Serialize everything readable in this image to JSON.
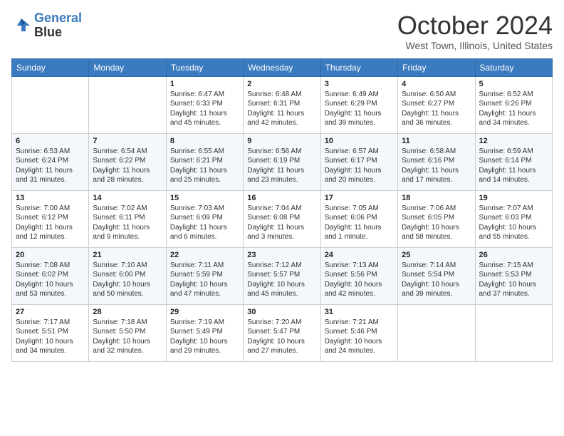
{
  "header": {
    "logo_line1": "General",
    "logo_line2": "Blue",
    "month": "October 2024",
    "location": "West Town, Illinois, United States"
  },
  "days_of_week": [
    "Sunday",
    "Monday",
    "Tuesday",
    "Wednesday",
    "Thursday",
    "Friday",
    "Saturday"
  ],
  "weeks": [
    [
      {
        "day": "",
        "sunrise": "",
        "sunset": "",
        "daylight": ""
      },
      {
        "day": "",
        "sunrise": "",
        "sunset": "",
        "daylight": ""
      },
      {
        "day": "1",
        "sunrise": "Sunrise: 6:47 AM",
        "sunset": "Sunset: 6:33 PM",
        "daylight": "Daylight: 11 hours and 45 minutes."
      },
      {
        "day": "2",
        "sunrise": "Sunrise: 6:48 AM",
        "sunset": "Sunset: 6:31 PM",
        "daylight": "Daylight: 11 hours and 42 minutes."
      },
      {
        "day": "3",
        "sunrise": "Sunrise: 6:49 AM",
        "sunset": "Sunset: 6:29 PM",
        "daylight": "Daylight: 11 hours and 39 minutes."
      },
      {
        "day": "4",
        "sunrise": "Sunrise: 6:50 AM",
        "sunset": "Sunset: 6:27 PM",
        "daylight": "Daylight: 11 hours and 36 minutes."
      },
      {
        "day": "5",
        "sunrise": "Sunrise: 6:52 AM",
        "sunset": "Sunset: 6:26 PM",
        "daylight": "Daylight: 11 hours and 34 minutes."
      }
    ],
    [
      {
        "day": "6",
        "sunrise": "Sunrise: 6:53 AM",
        "sunset": "Sunset: 6:24 PM",
        "daylight": "Daylight: 11 hours and 31 minutes."
      },
      {
        "day": "7",
        "sunrise": "Sunrise: 6:54 AM",
        "sunset": "Sunset: 6:22 PM",
        "daylight": "Daylight: 11 hours and 28 minutes."
      },
      {
        "day": "8",
        "sunrise": "Sunrise: 6:55 AM",
        "sunset": "Sunset: 6:21 PM",
        "daylight": "Daylight: 11 hours and 25 minutes."
      },
      {
        "day": "9",
        "sunrise": "Sunrise: 6:56 AM",
        "sunset": "Sunset: 6:19 PM",
        "daylight": "Daylight: 11 hours and 23 minutes."
      },
      {
        "day": "10",
        "sunrise": "Sunrise: 6:57 AM",
        "sunset": "Sunset: 6:17 PM",
        "daylight": "Daylight: 11 hours and 20 minutes."
      },
      {
        "day": "11",
        "sunrise": "Sunrise: 6:58 AM",
        "sunset": "Sunset: 6:16 PM",
        "daylight": "Daylight: 11 hours and 17 minutes."
      },
      {
        "day": "12",
        "sunrise": "Sunrise: 6:59 AM",
        "sunset": "Sunset: 6:14 PM",
        "daylight": "Daylight: 11 hours and 14 minutes."
      }
    ],
    [
      {
        "day": "13",
        "sunrise": "Sunrise: 7:00 AM",
        "sunset": "Sunset: 6:12 PM",
        "daylight": "Daylight: 11 hours and 12 minutes."
      },
      {
        "day": "14",
        "sunrise": "Sunrise: 7:02 AM",
        "sunset": "Sunset: 6:11 PM",
        "daylight": "Daylight: 11 hours and 9 minutes."
      },
      {
        "day": "15",
        "sunrise": "Sunrise: 7:03 AM",
        "sunset": "Sunset: 6:09 PM",
        "daylight": "Daylight: 11 hours and 6 minutes."
      },
      {
        "day": "16",
        "sunrise": "Sunrise: 7:04 AM",
        "sunset": "Sunset: 6:08 PM",
        "daylight": "Daylight: 11 hours and 3 minutes."
      },
      {
        "day": "17",
        "sunrise": "Sunrise: 7:05 AM",
        "sunset": "Sunset: 6:06 PM",
        "daylight": "Daylight: 11 hours and 1 minute."
      },
      {
        "day": "18",
        "sunrise": "Sunrise: 7:06 AM",
        "sunset": "Sunset: 6:05 PM",
        "daylight": "Daylight: 10 hours and 58 minutes."
      },
      {
        "day": "19",
        "sunrise": "Sunrise: 7:07 AM",
        "sunset": "Sunset: 6:03 PM",
        "daylight": "Daylight: 10 hours and 55 minutes."
      }
    ],
    [
      {
        "day": "20",
        "sunrise": "Sunrise: 7:08 AM",
        "sunset": "Sunset: 6:02 PM",
        "daylight": "Daylight: 10 hours and 53 minutes."
      },
      {
        "day": "21",
        "sunrise": "Sunrise: 7:10 AM",
        "sunset": "Sunset: 6:00 PM",
        "daylight": "Daylight: 10 hours and 50 minutes."
      },
      {
        "day": "22",
        "sunrise": "Sunrise: 7:11 AM",
        "sunset": "Sunset: 5:59 PM",
        "daylight": "Daylight: 10 hours and 47 minutes."
      },
      {
        "day": "23",
        "sunrise": "Sunrise: 7:12 AM",
        "sunset": "Sunset: 5:57 PM",
        "daylight": "Daylight: 10 hours and 45 minutes."
      },
      {
        "day": "24",
        "sunrise": "Sunrise: 7:13 AM",
        "sunset": "Sunset: 5:56 PM",
        "daylight": "Daylight: 10 hours and 42 minutes."
      },
      {
        "day": "25",
        "sunrise": "Sunrise: 7:14 AM",
        "sunset": "Sunset: 5:54 PM",
        "daylight": "Daylight: 10 hours and 39 minutes."
      },
      {
        "day": "26",
        "sunrise": "Sunrise: 7:15 AM",
        "sunset": "Sunset: 5:53 PM",
        "daylight": "Daylight: 10 hours and 37 minutes."
      }
    ],
    [
      {
        "day": "27",
        "sunrise": "Sunrise: 7:17 AM",
        "sunset": "Sunset: 5:51 PM",
        "daylight": "Daylight: 10 hours and 34 minutes."
      },
      {
        "day": "28",
        "sunrise": "Sunrise: 7:18 AM",
        "sunset": "Sunset: 5:50 PM",
        "daylight": "Daylight: 10 hours and 32 minutes."
      },
      {
        "day": "29",
        "sunrise": "Sunrise: 7:19 AM",
        "sunset": "Sunset: 5:49 PM",
        "daylight": "Daylight: 10 hours and 29 minutes."
      },
      {
        "day": "30",
        "sunrise": "Sunrise: 7:20 AM",
        "sunset": "Sunset: 5:47 PM",
        "daylight": "Daylight: 10 hours and 27 minutes."
      },
      {
        "day": "31",
        "sunrise": "Sunrise: 7:21 AM",
        "sunset": "Sunset: 5:46 PM",
        "daylight": "Daylight: 10 hours and 24 minutes."
      },
      {
        "day": "",
        "sunrise": "",
        "sunset": "",
        "daylight": ""
      },
      {
        "day": "",
        "sunrise": "",
        "sunset": "",
        "daylight": ""
      }
    ]
  ]
}
